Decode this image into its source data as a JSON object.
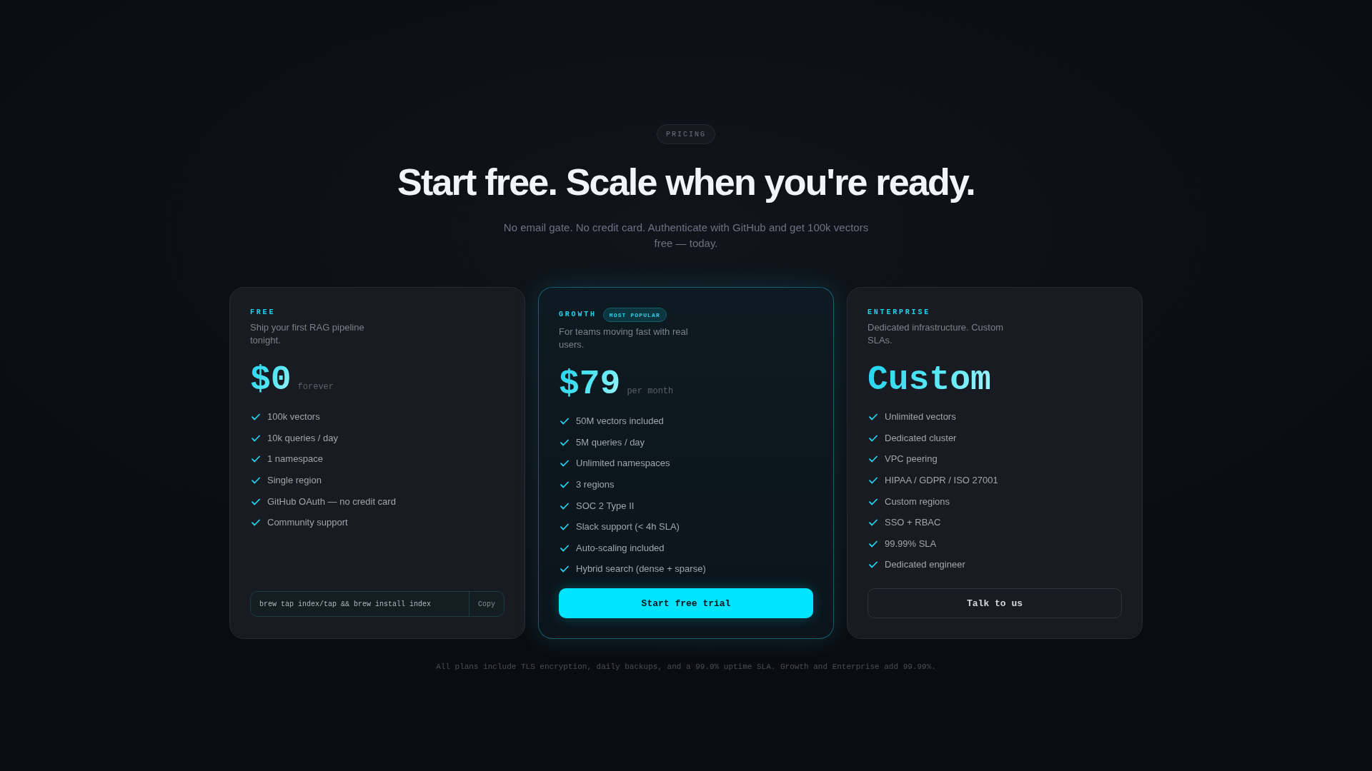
{
  "badge": {
    "label": "PRICING"
  },
  "hero": {
    "title": "Start free. Scale when you're ready.",
    "subtitle": "No email gate. No credit card. Authenticate with GitHub and get 100k vectors free — today."
  },
  "plans": [
    {
      "name": "FREE",
      "highlighted": false,
      "description": "Ship your first RAG pipeline tonight.",
      "price": "$0",
      "price_note": "forever",
      "features": [
        "100k vectors",
        "10k queries / day",
        "1 namespace",
        "Single region",
        "GitHub OAuth — no credit card",
        "Community support"
      ],
      "action": {
        "kind": "command",
        "command": "brew tap index/tap && brew install index",
        "button": "Copy"
      }
    },
    {
      "name": "GROWTH",
      "highlighted": true,
      "tag": "MOST POPULAR",
      "description": "For teams moving fast with real users.",
      "price": "$79",
      "price_note": "per month",
      "features": [
        "50M vectors included",
        "5M queries / day",
        "Unlimited namespaces",
        "3 regions",
        "SOC 2 Type II",
        "Slack support (< 4h SLA)",
        "Auto-scaling included",
        "Hybrid search (dense + sparse)"
      ],
      "action": {
        "kind": "primary",
        "label": "Start free trial"
      }
    },
    {
      "name": "ENTERPRISE",
      "highlighted": false,
      "description": "Dedicated infrastructure. Custom SLAs.",
      "price": "Custom",
      "features": [
        "Unlimited vectors",
        "Dedicated cluster",
        "VPC peering",
        "HIPAA / GDPR / ISO 27001",
        "Custom regions",
        "SSO + RBAC",
        "99.99% SLA",
        "Dedicated engineer"
      ],
      "action": {
        "kind": "secondary",
        "label": "Talk to us"
      }
    }
  ],
  "footnote": "All plans include TLS encryption, daily backups, and a 99.9% uptime SLA. Growth and Enterprise add 99.99%."
}
